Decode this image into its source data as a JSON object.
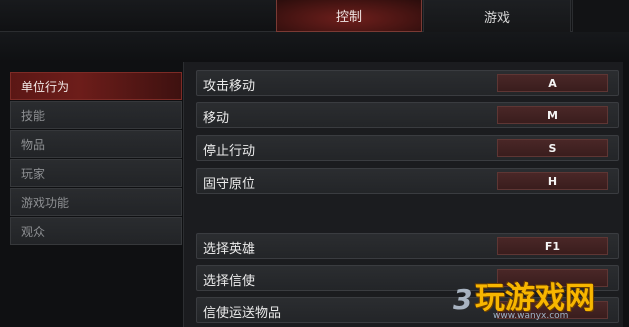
{
  "tabs": {
    "control": "控制",
    "game": "游戏"
  },
  "sidebar": {
    "items": [
      {
        "label": "单位行为",
        "active": true
      },
      {
        "label": "技能",
        "active": false
      },
      {
        "label": "物品",
        "active": false
      },
      {
        "label": "玩家",
        "active": false
      },
      {
        "label": "游戏功能",
        "active": false
      },
      {
        "label": "观众",
        "active": false
      }
    ]
  },
  "bindings": [
    {
      "action": "攻击移动",
      "key": "A"
    },
    {
      "action": "移动",
      "key": "M"
    },
    {
      "action": "停止行动",
      "key": "S"
    },
    {
      "action": "固守原位",
      "key": "H"
    },
    {
      "action": "选择英雄",
      "key": "F1"
    },
    {
      "action": "选择信使",
      "key": ""
    },
    {
      "action": "信使运送物品",
      "key": ""
    }
  ],
  "watermark": {
    "text": "玩游戏网",
    "num": "3",
    "url": "www.wanyx.com"
  },
  "colors": {
    "accent": "#6d1d1a",
    "key_button": "#4a2727",
    "background": "#0f1012",
    "panel": "#1b1c1f"
  }
}
